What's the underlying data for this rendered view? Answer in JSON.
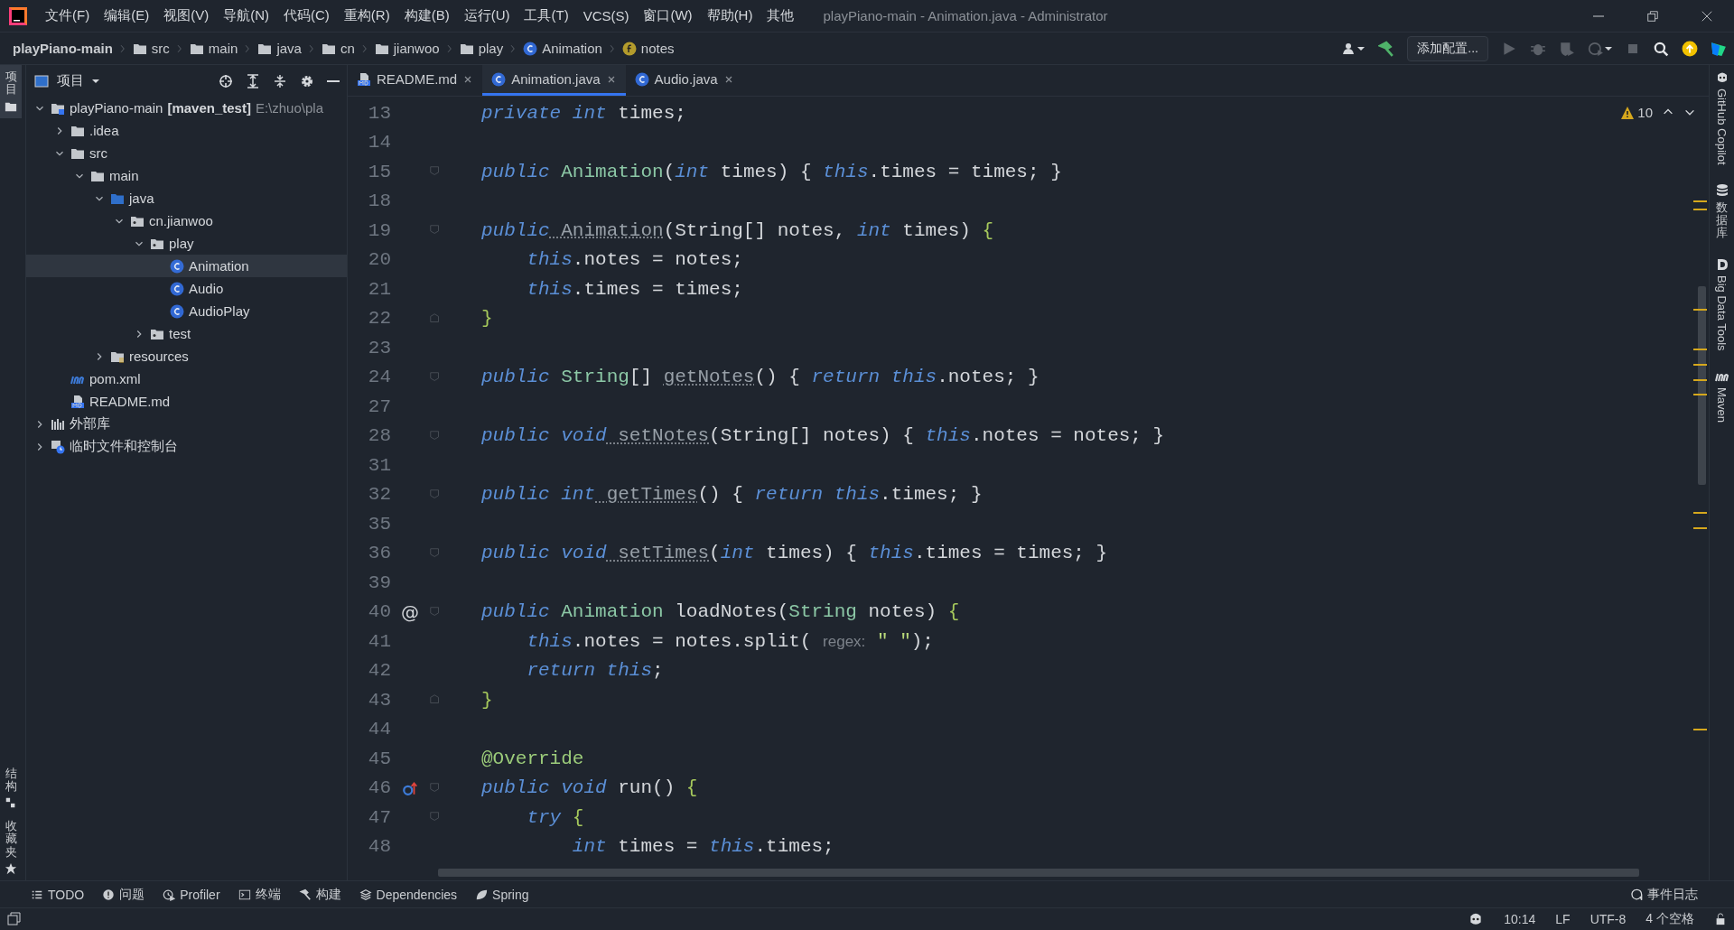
{
  "window": {
    "title": "playPiano-main - Animation.java - Administrator"
  },
  "menu": [
    "文件(F)",
    "编辑(E)",
    "视图(V)",
    "导航(N)",
    "代码(C)",
    "重构(R)",
    "构建(B)",
    "运行(U)",
    "工具(T)",
    "VCS(S)",
    "窗口(W)",
    "帮助(H)",
    "其他"
  ],
  "breadcrumb": [
    {
      "label": "playPiano-main",
      "kind": "project"
    },
    {
      "label": "src",
      "kind": "folder"
    },
    {
      "label": "main",
      "kind": "folder"
    },
    {
      "label": "java",
      "kind": "folder"
    },
    {
      "label": "cn",
      "kind": "folder"
    },
    {
      "label": "jianwoo",
      "kind": "folder"
    },
    {
      "label": "play",
      "kind": "folder"
    },
    {
      "label": "Animation",
      "kind": "class"
    },
    {
      "label": "notes",
      "kind": "field"
    }
  ],
  "toolbar": {
    "config_button": "添加配置..."
  },
  "left_strip": {
    "top": [
      {
        "label": "项目",
        "selected": true
      }
    ],
    "bottom": [
      {
        "label": "结构",
        "selected": false
      },
      {
        "label": "收藏夹",
        "selected": false
      }
    ]
  },
  "project_panel": {
    "title": "项目",
    "tree": [
      {
        "label": "playPiano-main",
        "tag": "[maven_test]",
        "path": "E:\\zhuo\\pla",
        "kind": "module",
        "expanded": true,
        "selected": false,
        "children": [
          {
            "label": ".idea",
            "kind": "folder",
            "expanded": false,
            "selected": false
          },
          {
            "label": "src",
            "kind": "folder",
            "expanded": true,
            "selected": false,
            "children": [
              {
                "label": "main",
                "kind": "folder",
                "expanded": true,
                "selected": false,
                "children": [
                  {
                    "label": "java",
                    "kind": "source",
                    "expanded": true,
                    "selected": false,
                    "children": [
                      {
                        "label": "cn.jianwoo",
                        "kind": "package",
                        "expanded": true,
                        "selected": false,
                        "children": [
                          {
                            "label": "play",
                            "kind": "package",
                            "expanded": true,
                            "selected": false,
                            "children": [
                              {
                                "label": "Animation",
                                "kind": "class",
                                "selected": true
                              },
                              {
                                "label": "Audio",
                                "kind": "class",
                                "selected": false
                              },
                              {
                                "label": "AudioPlay",
                                "kind": "class",
                                "selected": false
                              }
                            ]
                          },
                          {
                            "label": "test",
                            "kind": "package",
                            "expanded": false,
                            "selected": false
                          }
                        ]
                      }
                    ]
                  },
                  {
                    "label": "resources",
                    "kind": "resources",
                    "expanded": false,
                    "selected": false
                  }
                ]
              }
            ]
          },
          {
            "label": "pom.xml",
            "kind": "maven",
            "selected": false
          },
          {
            "label": "README.md",
            "kind": "markdown",
            "selected": false
          }
        ]
      },
      {
        "label": "外部库",
        "kind": "library",
        "expanded": false,
        "selected": false
      },
      {
        "label": "临时文件和控制台",
        "kind": "scratch",
        "expanded": false,
        "selected": false
      }
    ]
  },
  "tabs": [
    {
      "label": "README.md",
      "kind": "markdown",
      "selected": false
    },
    {
      "label": "Animation.java",
      "kind": "class",
      "selected": true
    },
    {
      "label": "Audio.java",
      "kind": "class",
      "selected": false
    }
  ],
  "editor": {
    "warnings": "10",
    "lines": [
      {
        "number": "13",
        "kind": "code",
        "tokens": [
          {
            "kind": "keyword",
            "text": "private int"
          },
          {
            "kind": "plain",
            "text": " times;"
          }
        ]
      },
      {
        "number": "14",
        "kind": "blank"
      },
      {
        "number": "15",
        "kind": "block_start",
        "tokens": [
          {
            "kind": "keyword",
            "text": "public"
          },
          {
            "kind": "type",
            "text": " Animation"
          },
          {
            "kind": "plain",
            "text": "("
          },
          {
            "kind": "keyword",
            "text": "int"
          },
          {
            "kind": "plain",
            "text": " times) { "
          },
          {
            "kind": "keyword",
            "text": "this"
          },
          {
            "kind": "plain",
            "text": ".times = times; }"
          }
        ]
      },
      {
        "number": "18",
        "kind": "blank"
      },
      {
        "number": "19",
        "kind": "block_start",
        "tokens": [
          {
            "kind": "keyword",
            "text": "public"
          },
          {
            "kind": "unused",
            "text": " Animation"
          },
          {
            "kind": "plain",
            "text": "(String[] notes, "
          },
          {
            "kind": "keyword",
            "text": "int"
          },
          {
            "kind": "plain",
            "text": " times) "
          },
          {
            "kind": "brace",
            "text": "{"
          }
        ]
      },
      {
        "number": "20",
        "kind": "code",
        "tokens": [
          {
            "kind": "keyword",
            "text": "    this"
          },
          {
            "kind": "plain",
            "text": ".notes = notes;"
          }
        ]
      },
      {
        "number": "21",
        "kind": "code",
        "tokens": [
          {
            "kind": "keyword",
            "text": "    this"
          },
          {
            "kind": "plain",
            "text": ".times = times;"
          }
        ]
      },
      {
        "number": "22",
        "kind": "block_end",
        "tokens": [
          {
            "kind": "brace",
            "text": "}"
          }
        ]
      },
      {
        "number": "23",
        "kind": "blank"
      },
      {
        "number": "24",
        "kind": "block_start",
        "tokens": [
          {
            "kind": "keyword",
            "text": "public"
          },
          {
            "kind": "type",
            "text": " String"
          },
          {
            "kind": "plain",
            "text": "[] "
          },
          {
            "kind": "unused",
            "text": "getNotes"
          },
          {
            "kind": "plain",
            "text": "() { "
          },
          {
            "kind": "keyword",
            "text": "return this"
          },
          {
            "kind": "plain",
            "text": ".notes; }"
          }
        ]
      },
      {
        "number": "27",
        "kind": "blank"
      },
      {
        "number": "28",
        "kind": "block_start",
        "tokens": [
          {
            "kind": "keyword",
            "text": "public void"
          },
          {
            "kind": "unused",
            "text": " setNotes"
          },
          {
            "kind": "plain",
            "text": "(String[] notes) { "
          },
          {
            "kind": "keyword",
            "text": "this"
          },
          {
            "kind": "plain",
            "text": ".notes = notes; }"
          }
        ]
      },
      {
        "number": "31",
        "kind": "blank"
      },
      {
        "number": "32",
        "kind": "block_start",
        "tokens": [
          {
            "kind": "keyword",
            "text": "public int"
          },
          {
            "kind": "unused",
            "text": " getTimes"
          },
          {
            "kind": "plain",
            "text": "() { "
          },
          {
            "kind": "keyword",
            "text": "return this"
          },
          {
            "kind": "plain",
            "text": ".times; }"
          }
        ]
      },
      {
        "number": "35",
        "kind": "blank"
      },
      {
        "number": "36",
        "kind": "block_start",
        "tokens": [
          {
            "kind": "keyword",
            "text": "public void"
          },
          {
            "kind": "unused",
            "text": " setTimes"
          },
          {
            "kind": "plain",
            "text": "("
          },
          {
            "kind": "keyword",
            "text": "int"
          },
          {
            "kind": "plain",
            "text": " times) { "
          },
          {
            "kind": "keyword",
            "text": "this"
          },
          {
            "kind": "plain",
            "text": ".times = times; }"
          }
        ]
      },
      {
        "number": "39",
        "kind": "blank"
      },
      {
        "number": "40",
        "kind": "block_start",
        "gutter_text": "@",
        "tokens": [
          {
            "kind": "keyword",
            "text": "public"
          },
          {
            "kind": "type",
            "text": " Animation"
          },
          {
            "kind": "plain",
            "text": " loadNotes("
          },
          {
            "kind": "type",
            "text": "String"
          },
          {
            "kind": "plain",
            "text": " notes) "
          },
          {
            "kind": "brace",
            "text": "{"
          }
        ]
      },
      {
        "number": "41",
        "kind": "code",
        "tokens": [
          {
            "kind": "keyword",
            "text": "    this"
          },
          {
            "kind": "plain",
            "text": ".notes = notes.split( "
          },
          {
            "kind": "hint",
            "text": "regex:"
          },
          {
            "kind": "string",
            "text": " \" \""
          },
          {
            "kind": "plain",
            "text": ");"
          }
        ]
      },
      {
        "number": "42",
        "kind": "code",
        "tokens": [
          {
            "kind": "keyword",
            "text": "    return this"
          },
          {
            "kind": "plain",
            "text": ";"
          }
        ]
      },
      {
        "number": "43",
        "kind": "block_end",
        "tokens": [
          {
            "kind": "brace",
            "text": "}"
          }
        ]
      },
      {
        "number": "44",
        "kind": "blank"
      },
      {
        "number": "45",
        "kind": "code",
        "tokens": [
          {
            "kind": "annotation",
            "text": "@Override"
          }
        ]
      },
      {
        "number": "46",
        "kind": "block_start",
        "override": true,
        "tokens": [
          {
            "kind": "keyword",
            "text": "public void"
          },
          {
            "kind": "plain",
            "text": " run() "
          },
          {
            "kind": "brace",
            "text": "{"
          }
        ]
      },
      {
        "number": "47",
        "kind": "block_start",
        "tokens": [
          {
            "kind": "keyword",
            "text": "    try"
          },
          {
            "kind": "brace",
            "text": " {"
          }
        ]
      },
      {
        "number": "48",
        "kind": "code",
        "tokens": [
          {
            "kind": "keyword",
            "text": "        int"
          },
          {
            "kind": "plain",
            "text": " times = "
          },
          {
            "kind": "keyword",
            "text": "this"
          },
          {
            "kind": "plain",
            "text": ".times;"
          }
        ]
      }
    ]
  },
  "right_strip": [
    {
      "label": "GitHub Copilot",
      "kind": "copilot"
    },
    {
      "label": "数据库",
      "kind": "database"
    },
    {
      "label": "Big Data Tools",
      "kind": "bigdata"
    },
    {
      "label": "Maven",
      "kind": "maven"
    }
  ],
  "tool_windows": [
    {
      "label": "TODO",
      "kind": "list"
    },
    {
      "label": "问题",
      "kind": "problem"
    },
    {
      "label": "Profiler",
      "kind": "profiler"
    },
    {
      "label": "终端",
      "kind": "terminal"
    },
    {
      "label": "构建",
      "kind": "hammer"
    },
    {
      "label": "Dependencies",
      "kind": "layers"
    },
    {
      "label": "Spring",
      "kind": "leaf"
    }
  ],
  "event_log": "事件日志",
  "status_bar": [
    "10:14",
    "LF",
    "UTF-8",
    "4 个空格"
  ]
}
